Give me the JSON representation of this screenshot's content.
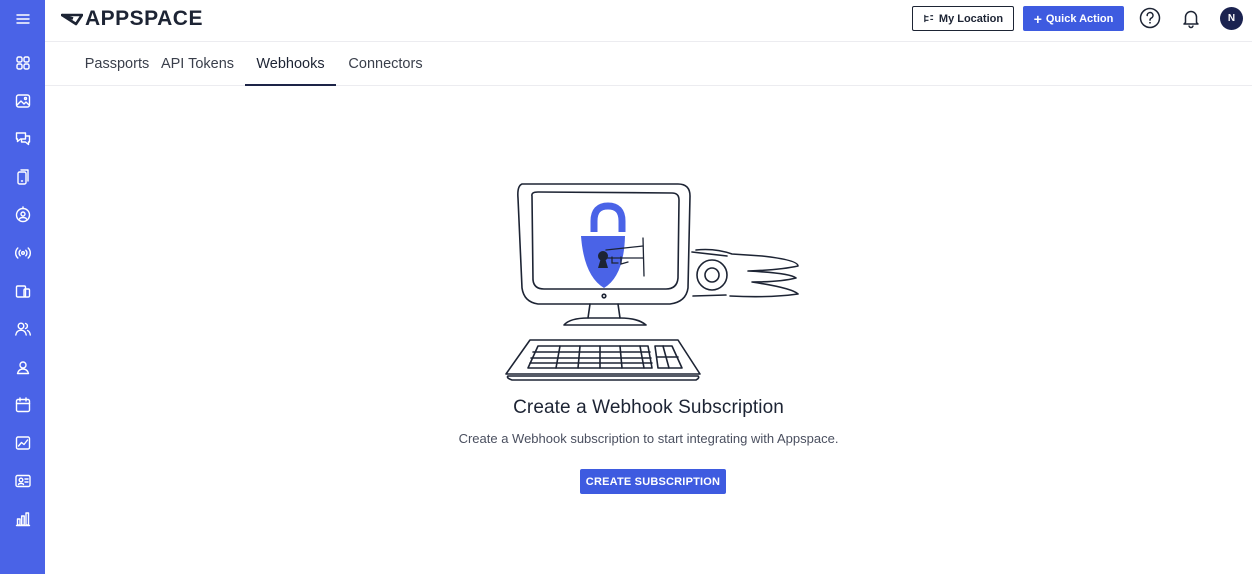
{
  "app": {
    "logo_text": "APPSPACE"
  },
  "header": {
    "location_button": "My Location",
    "quick_action_button": "Quick Action",
    "avatar_initial": "N"
  },
  "sidebar": {
    "items": [
      {
        "icon": "menu-icon"
      },
      {
        "icon": "dashboard-icon"
      },
      {
        "icon": "image-icon"
      },
      {
        "icon": "chat-icon"
      },
      {
        "icon": "device-icon"
      },
      {
        "icon": "user-badge-icon"
      },
      {
        "icon": "broadcast-icon"
      },
      {
        "icon": "screens-icon"
      },
      {
        "icon": "people-icon"
      },
      {
        "icon": "person-icon"
      },
      {
        "icon": "calendar-icon"
      },
      {
        "icon": "analytics-icon"
      },
      {
        "icon": "id-card-icon"
      },
      {
        "icon": "bar-chart-icon"
      }
    ]
  },
  "tabs": [
    {
      "label": "Passports"
    },
    {
      "label": "API Tokens"
    },
    {
      "label": "Webhooks",
      "active": true
    },
    {
      "label": "Connectors"
    }
  ],
  "empty_state": {
    "title": "Create a Webhook Subscription",
    "subtitle": "Create a Webhook subscription to start integrating with Appspace.",
    "button": "CREATE SUBSCRIPTION"
  },
  "colors": {
    "sidebar": "#4a63e7",
    "primary": "#3e5be0",
    "text": "#1d2434",
    "lock": "#4a63e7"
  }
}
